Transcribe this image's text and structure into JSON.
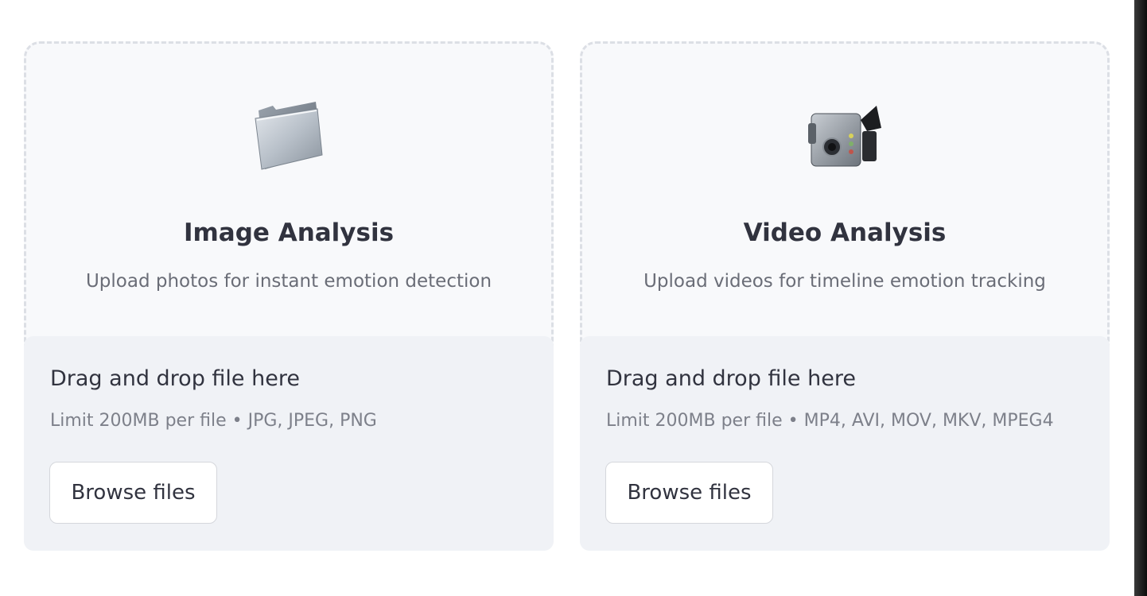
{
  "image_panel": {
    "icon": "folder-icon",
    "title": "Image Analysis",
    "description": "Upload photos for instant emotion detection",
    "uploader": {
      "drop_label": "Drag and drop file here",
      "limit_text": "Limit 200MB per file • JPG, JPEG, PNG",
      "browse_label": "Browse files"
    }
  },
  "video_panel": {
    "icon": "video-camera-icon",
    "title": "Video Analysis",
    "description": "Upload videos for timeline emotion tracking",
    "uploader": {
      "drop_label": "Drag and drop file here",
      "limit_text": "Limit 200MB per file • MP4, AVI, MOV, MKV, MPEG4",
      "browse_label": "Browse files"
    }
  },
  "colors": {
    "card_background": "#f8f9fb",
    "card_border": "#dcdfe5",
    "uploader_background": "#f0f2f6",
    "text_primary": "#31333f",
    "text_secondary": "#6a6d77"
  }
}
